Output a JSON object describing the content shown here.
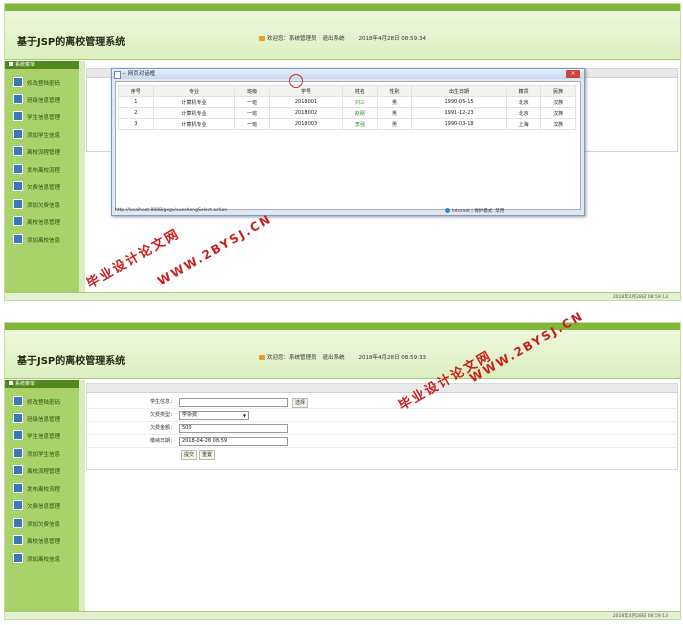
{
  "app": {
    "title": "基于JSP的离校管理系统",
    "welcome": "欢迎您：系统管理员",
    "logout": "退出系统"
  },
  "screen1": {
    "datetime": "2018年4月28日 08:59:34",
    "bottom_time": "2018年4月28日 08:59:13"
  },
  "screen2": {
    "datetime": "2018年4月28日 08:59:33",
    "bottom_time": "2018年4月28日 08:59:13"
  },
  "sidebar": {
    "header": "系统菜单",
    "items": [
      "修改登陆密码",
      "班级信息管理",
      "学生信息管理",
      "添加学生信息",
      "离校流程管理",
      "发布离校流程",
      "欠费信息管理",
      "添加欠费信息",
      "离校信息管理",
      "添加离校信息"
    ]
  },
  "popup": {
    "title": "-- 网页对话框",
    "columns": [
      "序号",
      "专业",
      "班级",
      "学号",
      "姓名",
      "性别",
      "出生日期",
      "籍贯",
      "民族"
    ],
    "rows": [
      [
        "1",
        "计算机专业",
        "一班",
        "2018001",
        "刘三",
        "男",
        "1990-05-15",
        "北京",
        "汉族"
      ],
      [
        "2",
        "计算机专业",
        "一班",
        "2018002",
        "赵刚",
        "男",
        "1991-12-23",
        "北京",
        "汉族"
      ],
      [
        "3",
        "计算机专业",
        "一班",
        "2018003",
        "李强",
        "男",
        "1990-03-18",
        "上海",
        "汉族"
      ]
    ],
    "url": "http://localhost:8888/gxgx/xueshengSelect.action",
    "status": "Internet | 保护模式: 禁用"
  },
  "form": {
    "student_label": "学生信息：",
    "student_value": "",
    "select_button": "选择",
    "fee_type_label": "欠费类型：",
    "fee_type_value": "学杂费",
    "amount_label": "欠费金额：",
    "amount_value": "500",
    "date_label": "缴纳日期：",
    "date_value": "2018-04-28 08:59",
    "submit": "提交",
    "reset": "重置"
  },
  "watermark": {
    "line1": "毕业设计论文网",
    "line2": "WWW.2BYSJ.CN"
  }
}
